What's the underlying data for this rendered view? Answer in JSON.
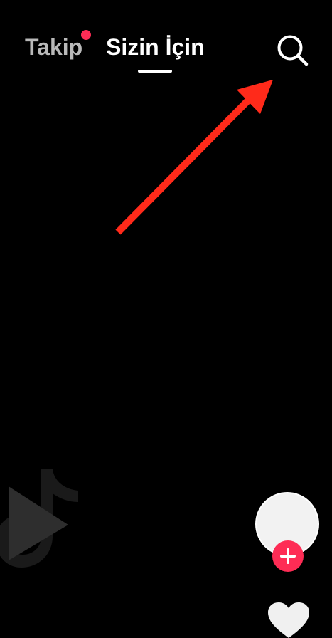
{
  "top_nav": {
    "tabs": [
      {
        "label": "Takip",
        "selected": false,
        "has_notification_dot": true
      },
      {
        "label": "Sizin İçin",
        "selected": true
      }
    ],
    "search_icon": "search-icon"
  },
  "annotation": {
    "icon": "arrow-icon",
    "color": "#ff2a1a",
    "points_to": "search-icon"
  },
  "watermark": {
    "icon": "tiktok-logo-icon"
  },
  "side_actions": {
    "avatar_icon": "avatar",
    "follow_icon": "plus-icon",
    "like_icon": "heart-icon"
  },
  "colors": {
    "background": "#000000",
    "accent": "#fe2c55",
    "inactive_tab": "#b9b9b9",
    "active_tab": "#ffffff"
  }
}
